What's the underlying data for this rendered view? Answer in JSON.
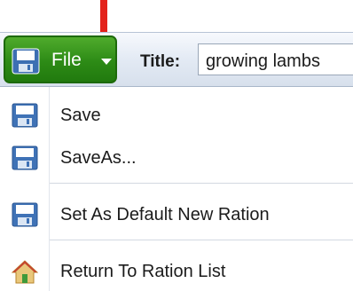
{
  "toolbar": {
    "file_label": "File",
    "title_label": "Title:",
    "title_value": "growing lambs"
  },
  "menu": {
    "items": [
      {
        "label": "Save",
        "icon": "save-icon"
      },
      {
        "label": "SaveAs...",
        "icon": "save-icon"
      },
      {
        "label": "Set As Default New Ration",
        "icon": "save-icon"
      },
      {
        "label": "Return To Ration List",
        "icon": "home-icon"
      }
    ]
  },
  "colors": {
    "file_button": "#2d8b16",
    "annotation_arrow": "#e3221b",
    "toolbar": "#e3eaf4"
  }
}
